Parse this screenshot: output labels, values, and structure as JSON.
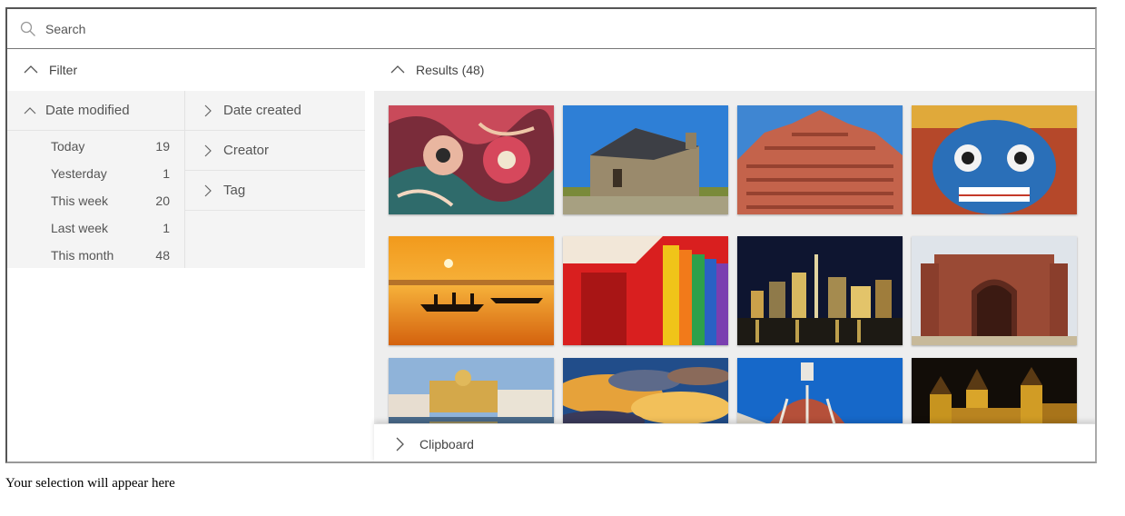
{
  "search": {
    "placeholder": "Search"
  },
  "filter": {
    "label": "Filter"
  },
  "results": {
    "label": "Results (48)"
  },
  "date_modified": {
    "title": "Date modified",
    "rows": [
      {
        "label": "Today",
        "count": "19"
      },
      {
        "label": "Yesterday",
        "count": "1"
      },
      {
        "label": "This week",
        "count": "20"
      },
      {
        "label": "Last week",
        "count": "1"
      },
      {
        "label": "This month",
        "count": "48"
      }
    ]
  },
  "other_facets": [
    "Date created",
    "Creator",
    "Tag"
  ],
  "thumbnails": [
    {
      "name": "thumbnail-tribal-mask-art"
    },
    {
      "name": "thumbnail-stone-church"
    },
    {
      "name": "thumbnail-hawa-mahal"
    },
    {
      "name": "thumbnail-blue-mask"
    },
    {
      "name": "thumbnail-river-sunset"
    },
    {
      "name": "thumbnail-colorful-huts"
    },
    {
      "name": "thumbnail-city-skyline-night"
    },
    {
      "name": "thumbnail-red-fort-gate"
    },
    {
      "name": "thumbnail-golden-temple"
    },
    {
      "name": "thumbnail-dramatic-clouds"
    },
    {
      "name": "thumbnail-cathedral-dome"
    },
    {
      "name": "thumbnail-castle-night"
    }
  ],
  "clipboard": {
    "label": "Clipboard"
  },
  "selection_text": "Your selection will appear here",
  "colors": {
    "panel_bg": "#f4f4f4",
    "grid_bg": "#eeeeee",
    "text": "#444444"
  }
}
